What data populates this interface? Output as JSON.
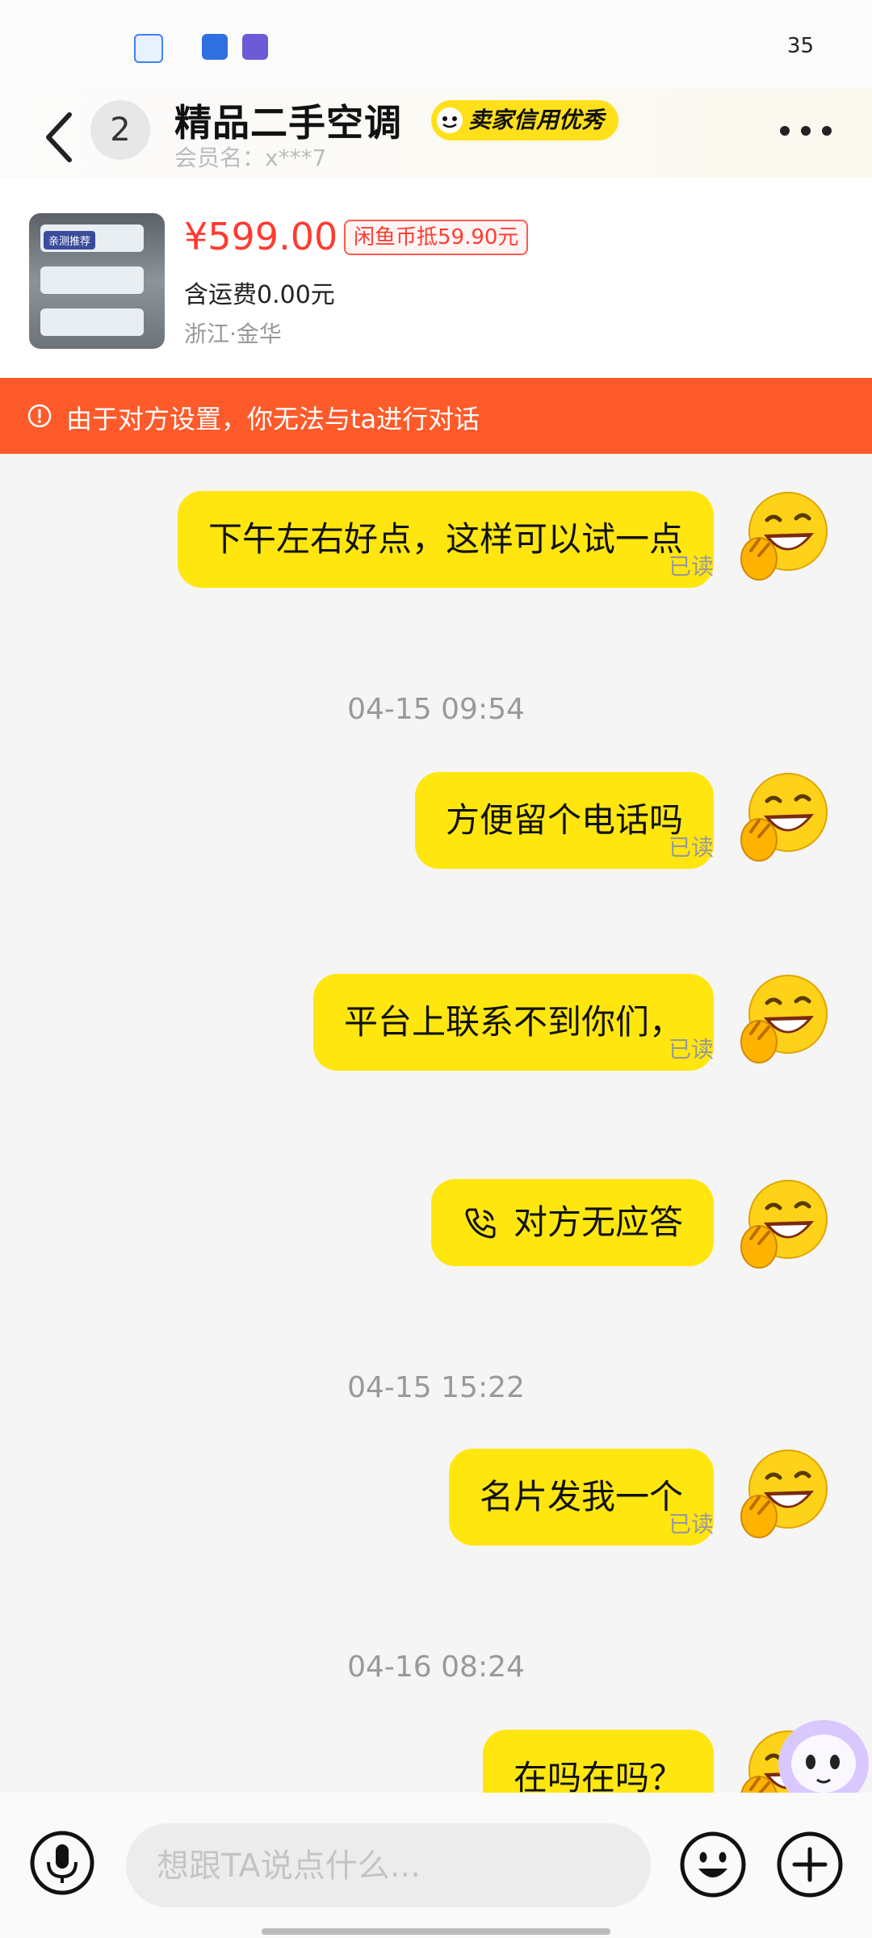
{
  "status_bar": {
    "battery": "35",
    "app_icons": [
      "location-app-icon",
      "1688-app-icon",
      "tie-app-icon"
    ]
  },
  "header": {
    "unread_count": "2",
    "title": "精品二手空调",
    "credit_badge": "卖家信用优秀",
    "member_name": "会员名：x***7"
  },
  "product": {
    "price": "¥599.00",
    "coin_deduct": "闲鱼币抵59.90元",
    "shipping": "含运费0.00元",
    "location": "浙江·金华",
    "thumb_tag": "亲测推荐"
  },
  "warning": {
    "text": "由于对方设置，你无法与ta进行对话"
  },
  "messages": [
    {
      "text": "下午左右好点，这样可以试一点",
      "status": "已读"
    },
    {
      "timestamp": "04-15 09:54"
    },
    {
      "text": "方便留个电话吗",
      "status": "已读"
    },
    {
      "text": "平台上联系不到你们，",
      "status": "已读"
    },
    {
      "text": "对方无应答",
      "type": "call"
    },
    {
      "timestamp": "04-15 15:22"
    },
    {
      "text": "名片发我一个",
      "status": "已读"
    },
    {
      "timestamp": "04-16 08:24"
    },
    {
      "text": "在吗在吗？"
    }
  ],
  "input": {
    "placeholder": "想跟TA说点什么..."
  },
  "colors": {
    "bubble": "#ffe60f",
    "warning": "#ff5a2a",
    "price": "#ff3b30"
  }
}
